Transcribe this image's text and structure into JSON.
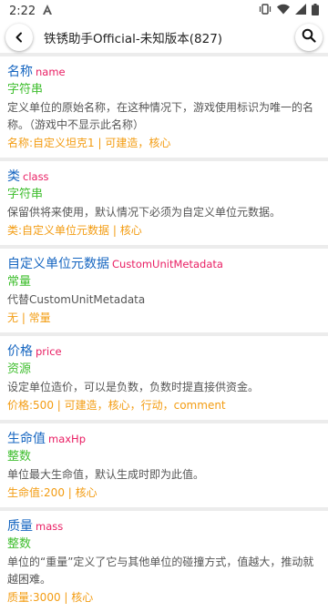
{
  "status": {
    "time": "2:22"
  },
  "header": {
    "title": "铁锈助手Official-未知版本(827)"
  },
  "cards": [
    {
      "name": "名称",
      "ident": "name",
      "type": "字符串",
      "desc": "定义单位的原始名称，在这种情况下，游戏使用标识为唯一的名称。（游戏中不显示此名称）",
      "meta": "名称:自定义坦克1 | 可建造，核心"
    },
    {
      "name": "类",
      "ident": "class",
      "type": "字符串",
      "desc": "保留供将来使用，默认情况下必须为自定义单位元数据。",
      "meta": "类:自定义单位元数据 | 核心"
    },
    {
      "name": "自定义单位元数据",
      "ident": "CustomUnitMetadata",
      "type": "常量",
      "desc": "代替CustomUnitMetadata",
      "meta": "无 | 常量"
    },
    {
      "name": "价格",
      "ident": "price",
      "type": "资源",
      "desc": "设定单位造价，可以是负数，负数时提直接供资金。",
      "meta": "价格:500 | 可建造，核心，行动，comment"
    },
    {
      "name": "生命值",
      "ident": "maxHp",
      "type": "整数",
      "desc": "单位最大生命值，默认生成时即为此值。",
      "meta": "生命值:200 | 核心"
    },
    {
      "name": "质量",
      "ident": "mass",
      "type": "整数",
      "desc": "单位的“重量”定义了它与其他单位的碰撞方式，值越大，推动就越困难。",
      "meta": "质量:3000 | 核心"
    }
  ]
}
